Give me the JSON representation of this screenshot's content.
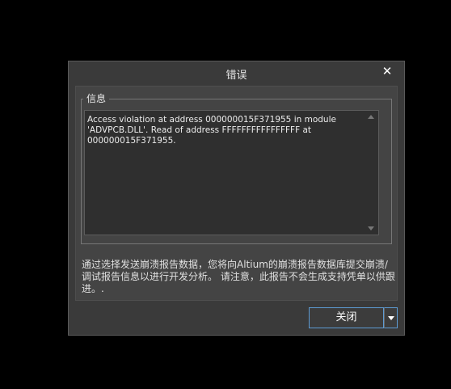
{
  "dialog": {
    "title": "错误",
    "close_glyph": "✕",
    "group_label": "信息",
    "error_message": "Access violation at address 000000015F371955 in module 'ADVPCB.DLL'. Read of address FFFFFFFFFFFFFFFF at 000000015F371955.",
    "note": "通过选择发送崩溃报告数据，您将向Altium的崩溃报告数据库提交崩溃/调试报告信息以进行开发分析。 请注意，此报告不会生成支持凭单以供跟进。.",
    "close_button_label": "关闭"
  },
  "colors": {
    "background": "#000000",
    "dialog": "#3a3a3a",
    "panel": "#444444",
    "textarea": "#2f2f2f",
    "button_border": "#5d9bd3"
  }
}
